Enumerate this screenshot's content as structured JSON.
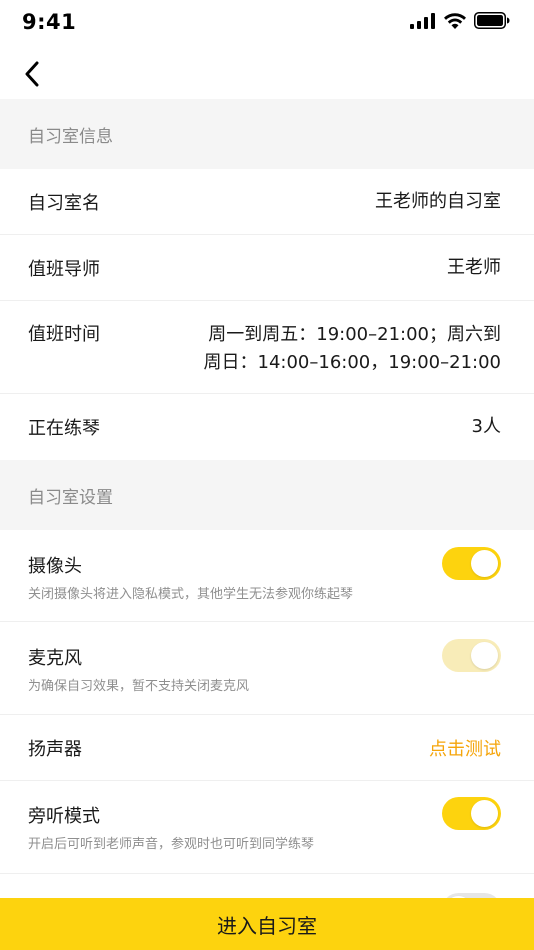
{
  "status_bar": {
    "time": "9:41"
  },
  "nav": {
    "back_icon": "chevron-left-icon"
  },
  "room_info": {
    "header": "自习室信息",
    "name_label": "自习室名",
    "name_value": "王老师的自习室",
    "teacher_label": "值班导师",
    "teacher_value": "王老师",
    "time_label": "值班时间",
    "time_value_line1": "周一到周五：19:00–21:00；周六到",
    "time_value_line2": "周日：14:00–16:00，19:00–21:00",
    "practicing_label": "正在练琴",
    "practicing_value": "3人"
  },
  "settings": {
    "header": "自习室设置",
    "camera": {
      "title": "摄像头",
      "desc": "关闭摄像头将进入隐私模式，其他学生无法参观你练起琴",
      "on": true
    },
    "microphone": {
      "title": "麦克风",
      "desc": "为确保自习效果，暂不支持关闭麦克风",
      "on": true,
      "disabled": true
    },
    "speaker": {
      "title": "扬声器",
      "action": "点击测试"
    },
    "listen_mode": {
      "title": "旁听模式",
      "desc": "开启后可听到老师声音，参观时也可听到同学练琴",
      "on": true
    },
    "next_item": {
      "on": false
    }
  },
  "enter_button": "进入自习室",
  "colors": {
    "accent": "#fdd30e",
    "link": "#f5a50b",
    "section_bg": "#f5f5f5"
  }
}
